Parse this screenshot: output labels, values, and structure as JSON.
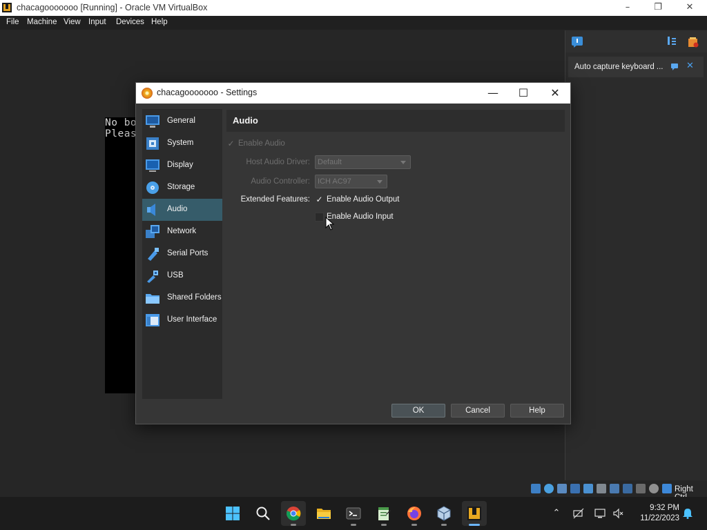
{
  "window": {
    "title": "chacagooooooo [Running] - Oracle VM VirtualBox",
    "controls": [
      "–",
      "❐",
      "✕"
    ]
  },
  "menu": [
    "File",
    "Machine",
    "View",
    "Input",
    "Devices",
    "Help"
  ],
  "vm_screen": {
    "lines": [
      "No bo",
      "Pleas"
    ]
  },
  "notification": {
    "text": "Auto capture keyboard ..."
  },
  "dialog": {
    "title": "chacagooooooo - Settings",
    "controls": [
      "—",
      "☐",
      "✕"
    ],
    "nav": [
      {
        "label": "General",
        "icon": "general-icon"
      },
      {
        "label": "System",
        "icon": "system-icon"
      },
      {
        "label": "Display",
        "icon": "display-icon"
      },
      {
        "label": "Storage",
        "icon": "storage-icon"
      },
      {
        "label": "Audio",
        "icon": "audio-icon",
        "selected": true
      },
      {
        "label": "Network",
        "icon": "network-icon"
      },
      {
        "label": "Serial Ports",
        "icon": "serial-ports-icon"
      },
      {
        "label": "USB",
        "icon": "usb-icon"
      },
      {
        "label": "Shared Folders",
        "icon": "shared-folders-icon"
      },
      {
        "label": "User Interface",
        "icon": "user-interface-icon"
      }
    ],
    "section_title": "Audio",
    "enable_audio": {
      "label": "Enable Audio",
      "checked": true,
      "disabled": true
    },
    "host_audio_driver": {
      "label": "Host Audio Driver:",
      "value": "Default"
    },
    "audio_controller": {
      "label": "Audio Controller:",
      "value": "ICH AC97"
    },
    "extended_features": {
      "label": "Extended Features:",
      "output": {
        "label": "Enable Audio Output",
        "checked": true
      },
      "input": {
        "label": "Enable Audio Input",
        "checked": false
      }
    },
    "buttons": {
      "ok": "OK",
      "cancel": "Cancel",
      "help": "Help"
    }
  },
  "statusbar": {
    "host_key": "Right Ctrl"
  },
  "taskbar": {
    "time": "9:32 PM",
    "date": "11/22/2023"
  },
  "colors": {
    "selection": "#365c6a",
    "dialog_bg": "#363636",
    "taskbar_accent": "#6cb6ff"
  }
}
